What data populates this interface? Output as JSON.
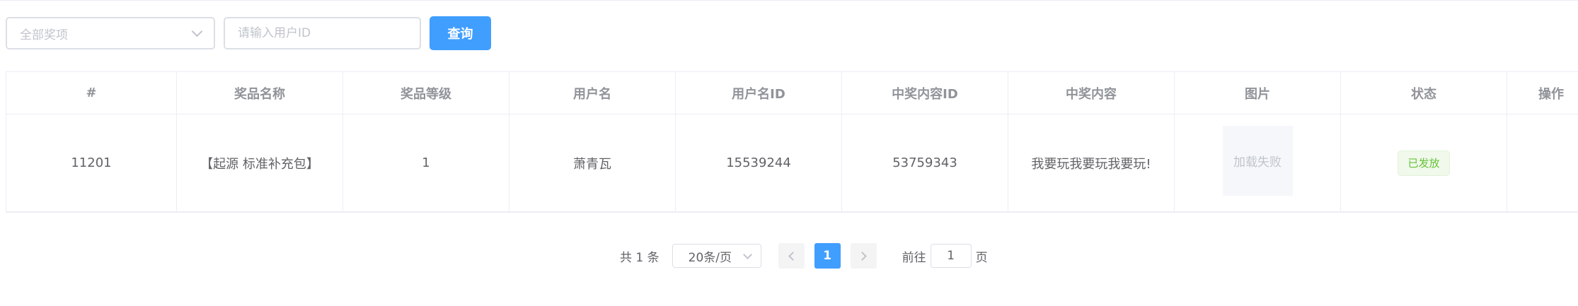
{
  "filters": {
    "prize_select": "全部奖项",
    "user_id_placeholder": "请输入用户ID",
    "query_button": "查询"
  },
  "table": {
    "columns": [
      "#",
      "奖品名称",
      "奖品等级",
      "用户名",
      "用户名ID",
      "中奖内容ID",
      "中奖内容",
      "图片",
      "状态",
      "操作"
    ],
    "rows": [
      {
        "id": "11201",
        "prize_name": "【起源 标准补充包】",
        "prize_level": "1",
        "username": "萧青瓦",
        "user_id": "15539244",
        "content_id": "53759343",
        "content": "我要玩我要玩我要玩!",
        "image_text": "加载失败",
        "status": "已发放",
        "action": ""
      }
    ]
  },
  "pagination": {
    "total": "共 1 条",
    "page_size": "20条/页",
    "current_page": "1",
    "goto_label": "前往",
    "goto_value": "1",
    "page_suffix": "页"
  },
  "colors": {
    "primary": "#409eff",
    "success": "#67c23a",
    "border": "#dcdfe6"
  },
  "icons": {
    "select_arrow": "chevron-down-icon",
    "prev": "chevron-left-icon",
    "next": "chevron-right-icon"
  }
}
